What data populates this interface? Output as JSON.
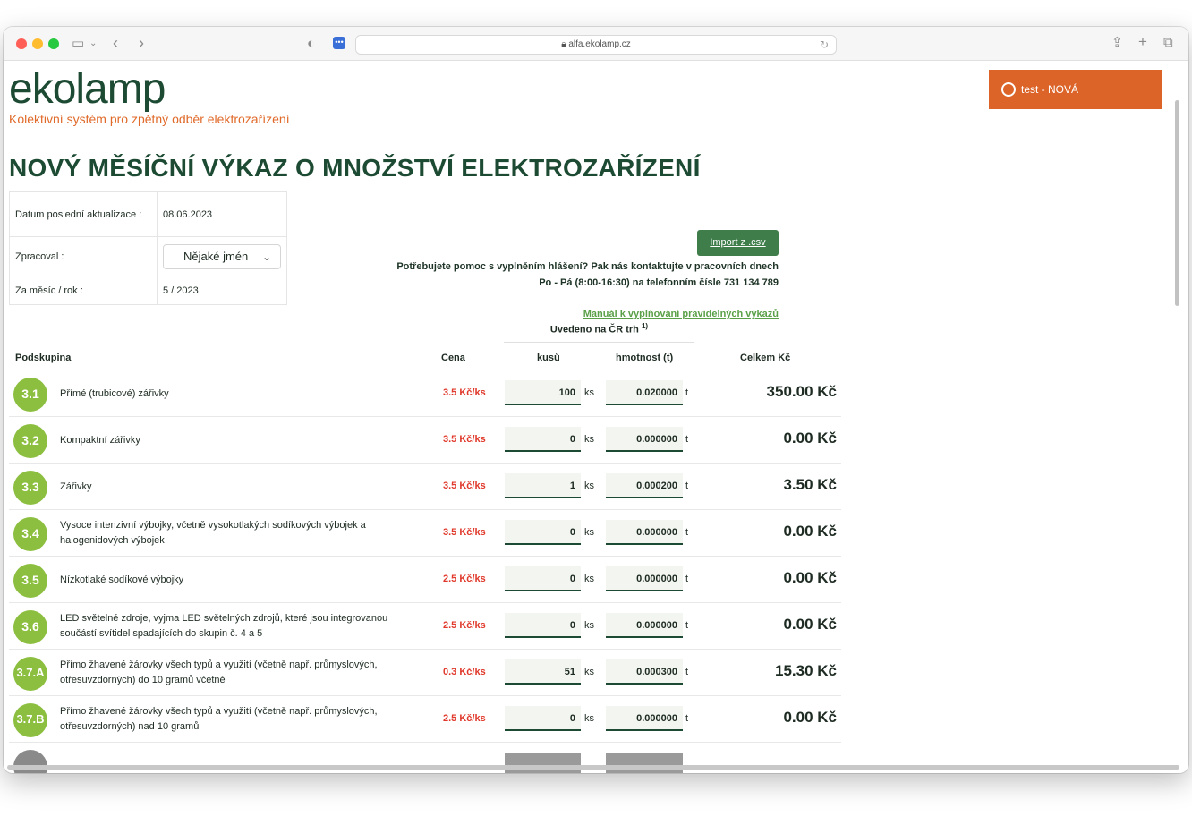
{
  "browser": {
    "url": "alfa.ekolamp.cz",
    "traffic_colors": [
      "#ff5f57",
      "#febc2e",
      "#28c840"
    ]
  },
  "header": {
    "logo": "ekolamp",
    "tagline": "Kolektivní systém pro zpětný odběr elektrozařízení",
    "user_button": "test - NOVÁ"
  },
  "page": {
    "title": "NOVÝ MĚSÍČNÍ VÝKAZ O MNOŽSTVÍ ELEKTROZAŘÍZENÍ"
  },
  "meta": {
    "rows": [
      {
        "label": "Datum poslední aktualizace :",
        "value": "08.06.2023"
      },
      {
        "label": "Zpracoval :",
        "value": "Nějaké jmén"
      },
      {
        "label": "Za měsíc / rok :",
        "value": "5 / 2023"
      }
    ]
  },
  "actions": {
    "import_label": "Import z .csv",
    "help_line1": "Potřebujete pomoc s vyplněním hlášení? Pak nás kontaktujte v pracovních dnech",
    "help_line2": "Po - Pá (8:00-16:30) na telefonním čísle 731 134 789",
    "manual_link": "Manuál k vyplňování pravidelných výkazů"
  },
  "table": {
    "market_header": "Uvedeno na ČR trh",
    "market_footnote": "1)",
    "columns": {
      "subgroup": "Podskupina",
      "price": "Cena",
      "pieces": "kusů",
      "weight": "hmotnost (t)",
      "total": "Celkem Kč"
    },
    "unit_ks": "ks",
    "unit_t": "t",
    "rows": [
      {
        "code": "3.1",
        "desc": "Přímé (trubicové) zářivky",
        "price": "3.5 Kč/ks",
        "ks": "100",
        "t": "0.020000",
        "total": "350.00 Kč"
      },
      {
        "code": "3.2",
        "desc": "Kompaktní zářivky",
        "price": "3.5 Kč/ks",
        "ks": "0",
        "t": "0.000000",
        "total": "0.00 Kč"
      },
      {
        "code": "3.3",
        "desc": "Zářivky",
        "price": "3.5 Kč/ks",
        "ks": "1",
        "t": "0.000200",
        "total": "3.50 Kč"
      },
      {
        "code": "3.4",
        "desc": "Vysoce intenzivní výbojky, včetně vysokotlakých sodíkových výbojek a halogenidových výbojek",
        "price": "3.5 Kč/ks",
        "ks": "0",
        "t": "0.000000",
        "total": "0.00 Kč"
      },
      {
        "code": "3.5",
        "desc": "Nízkotlaké sodíkové výbojky",
        "price": "2.5 Kč/ks",
        "ks": "0",
        "t": "0.000000",
        "total": "0.00 Kč"
      },
      {
        "code": "3.6",
        "desc": "LED světelné zdroje, vyjma LED světelných zdrojů, které jsou integrovanou součástí svítidel spadajících do skupin č. 4 a 5",
        "price": "2.5 Kč/ks",
        "ks": "0",
        "t": "0.000000",
        "total": "0.00 Kč"
      },
      {
        "code": "3.7.A",
        "desc": "Přímo žhavené žárovky všech typů a využití (včetně např. průmyslových, otřesuvzdorných) do 10 gramů včetně",
        "price": "0.3 Kč/ks",
        "ks": "51",
        "t": "0.000300",
        "total": "15.30 Kč"
      },
      {
        "code": "3.7.B",
        "desc": "Přímo žhavené žárovky všech typů a využití (včetně např. průmyslových, otřesuvzdorných) nad 10 gramů",
        "price": "2.5 Kč/ks",
        "ks": "0",
        "t": "0.000000",
        "total": "0.00 Kč"
      }
    ]
  },
  "colors": {
    "brand_green": "#1c4a32",
    "accent_orange": "#dc6429",
    "badge_green": "#8cbf3f",
    "price_red": "#e0382a"
  }
}
